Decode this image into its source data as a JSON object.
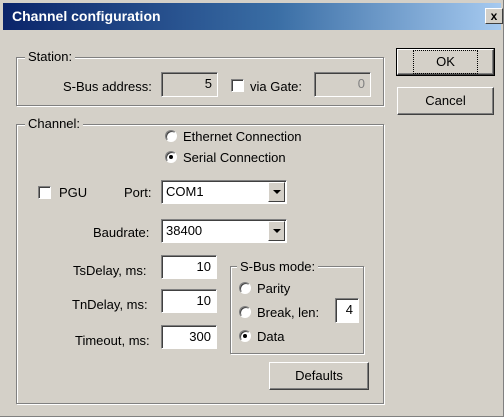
{
  "window": {
    "title": "Channel configuration",
    "close_label": "x"
  },
  "buttons": {
    "ok": "OK",
    "cancel": "Cancel",
    "defaults": "Defaults"
  },
  "station": {
    "title": "Station:",
    "sbus_address_label": "S-Bus address:",
    "sbus_address_value": "5",
    "via_gate_label": "via Gate:",
    "via_gate_checked": false,
    "via_gate_value": "0"
  },
  "channel": {
    "title": "Channel:",
    "ethernet_label": "Ethernet Connection",
    "serial_label": "Serial Connection",
    "selected_connection": "serial",
    "pgu_label": "PGU",
    "pgu_checked": false,
    "port_label": "Port:",
    "port_value": "COM1",
    "baudrate_label": "Baudrate:",
    "baudrate_value": "38400",
    "tsdelay_label": "TsDelay, ms:",
    "tsdelay_value": "10",
    "tndelay_label": "TnDelay, ms:",
    "tndelay_value": "10",
    "timeout_label": "Timeout, ms:",
    "timeout_value": "300"
  },
  "sbus_mode": {
    "title": "S-Bus mode:",
    "parity_label": "Parity",
    "break_label": "Break, len:",
    "break_len_value": "4",
    "data_label": "Data",
    "selected": "data"
  },
  "colors": {
    "face": "#d4d0c8",
    "title_start": "#0a246a",
    "title_end": "#a6caf0"
  }
}
